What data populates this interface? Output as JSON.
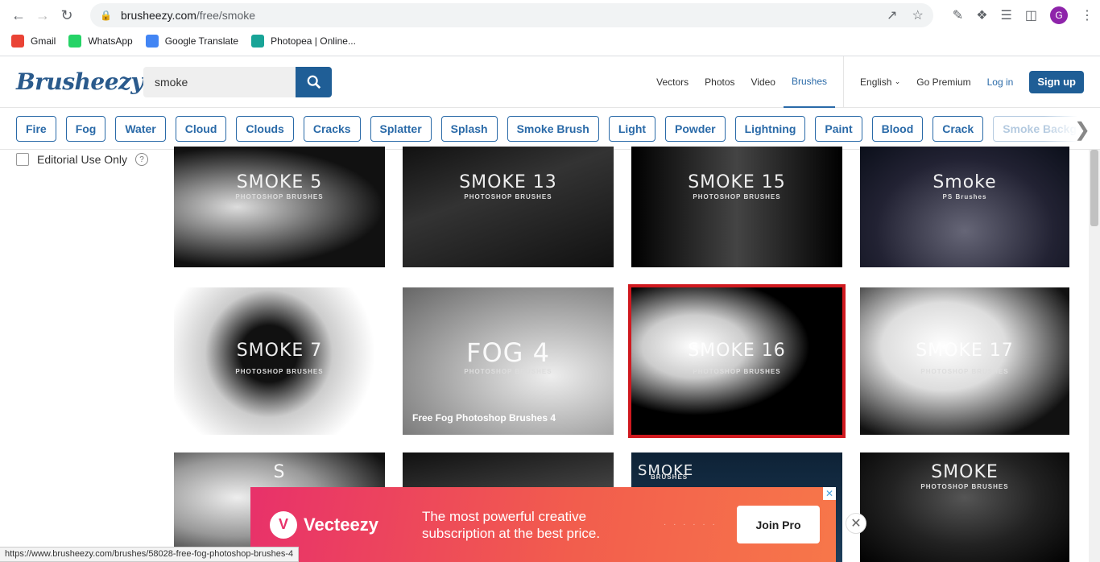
{
  "browser": {
    "url_domain": "brusheezy.com",
    "url_path": "/free/smoke",
    "avatar_letter": "G",
    "bookmarks": [
      {
        "label": "Gmail",
        "icon": "gmail-icon",
        "color": "#ea4335"
      },
      {
        "label": "WhatsApp",
        "icon": "whatsapp-icon",
        "color": "#25d366"
      },
      {
        "label": "Google Translate",
        "icon": "translate-icon",
        "color": "#4285f4"
      },
      {
        "label": "Photopea | Online...",
        "icon": "photopea-icon",
        "color": "#18a497"
      }
    ],
    "status_url": "https://www.brusheezy.com/brushes/58028-free-fog-photoshop-brushes-4"
  },
  "header": {
    "logo": "Brusheezy",
    "search_value": "smoke",
    "nav": [
      "Vectors",
      "Photos",
      "Video",
      "Brushes"
    ],
    "active_nav": "Brushes",
    "language": "English",
    "go_premium": "Go Premium",
    "login": "Log in",
    "signup": "Sign up"
  },
  "chips": [
    "Fire",
    "Fog",
    "Water",
    "Cloud",
    "Clouds",
    "Cracks",
    "Splatter",
    "Splash",
    "Smoke Brush",
    "Light",
    "Powder",
    "Lightning",
    "Paint",
    "Blood",
    "Crack",
    "Smoke Backgrou..."
  ],
  "filters": {
    "editorial_label": "Editorial Use Only",
    "editorial_checked": false
  },
  "tiles": [
    {
      "title": "SMOKE 5",
      "sub": "PHOTOSHOP BRUSHES"
    },
    {
      "title": "SMOKE 13",
      "sub": "PHOTOSHOP BRUSHES"
    },
    {
      "title": "SMOKE 15",
      "sub": "PHOTOSHOP BRUSHES"
    },
    {
      "title": "Smoke",
      "sub": "PS Brushes"
    },
    {
      "title": "SMOKE 7",
      "sub": "PHOTOSHOP BRUSHES"
    },
    {
      "title": "FOG 4",
      "sub": "PHOTOSHOP BRUSHES",
      "caption": "Free Fog Photoshop Brushes 4"
    },
    {
      "title": "SMOKE 16",
      "sub": "PHOTOSHOP BRUSHES"
    },
    {
      "title": "SMOKE 17",
      "sub": "PHOTOSHOP BRUSHES"
    },
    {
      "title": "S",
      "sub": ""
    },
    {
      "title": "",
      "sub": ""
    },
    {
      "title": "SMOKE",
      "sub": "BRUSHES"
    },
    {
      "title": "SMOKE",
      "sub": "PHOTOSHOP BRUSHES"
    }
  ],
  "ad": {
    "brand": "Vecteezy",
    "text": "The most powerful creative subscription at the best price.",
    "cta": "Join Pro"
  }
}
